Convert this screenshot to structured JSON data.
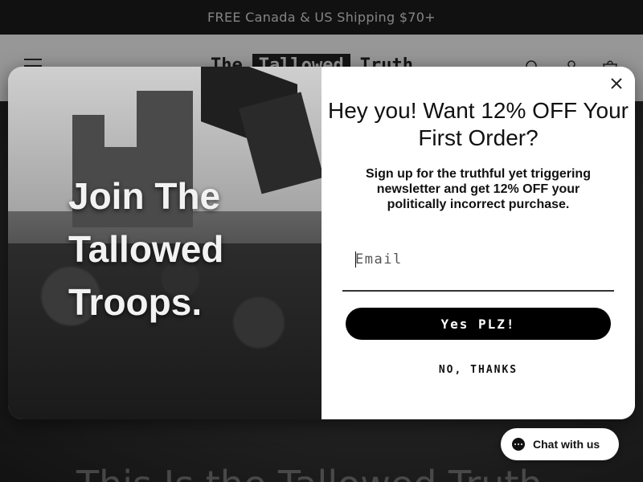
{
  "announcement": {
    "text": "FREE Canada & US Shipping $70+"
  },
  "header": {
    "logo": {
      "word1": "The",
      "word2": "Tallowed",
      "word3": "Truth"
    },
    "icons": [
      "menu-icon",
      "search-icon",
      "account-icon",
      "cart-icon"
    ]
  },
  "hero": {
    "heading": "This Is the Tallowed Truth"
  },
  "popup": {
    "image_heading_lines": [
      "Join The",
      "Tallowed",
      "Troops."
    ],
    "title": "Hey you! Want 12% OFF Your First Order?",
    "subtitle": "Sign up for the truthful yet triggering newsletter and get 12% OFF your politically incorrect purchase.",
    "email": {
      "placeholder": "Email",
      "value": ""
    },
    "submit_label": "Yes PLZ!",
    "decline_label": "NO, THANKS"
  },
  "chat": {
    "label": "Chat with us"
  },
  "colors": {
    "button": "#000000",
    "announcement_bg": "#1c1c1c",
    "popup_bg": "#ffffff"
  }
}
